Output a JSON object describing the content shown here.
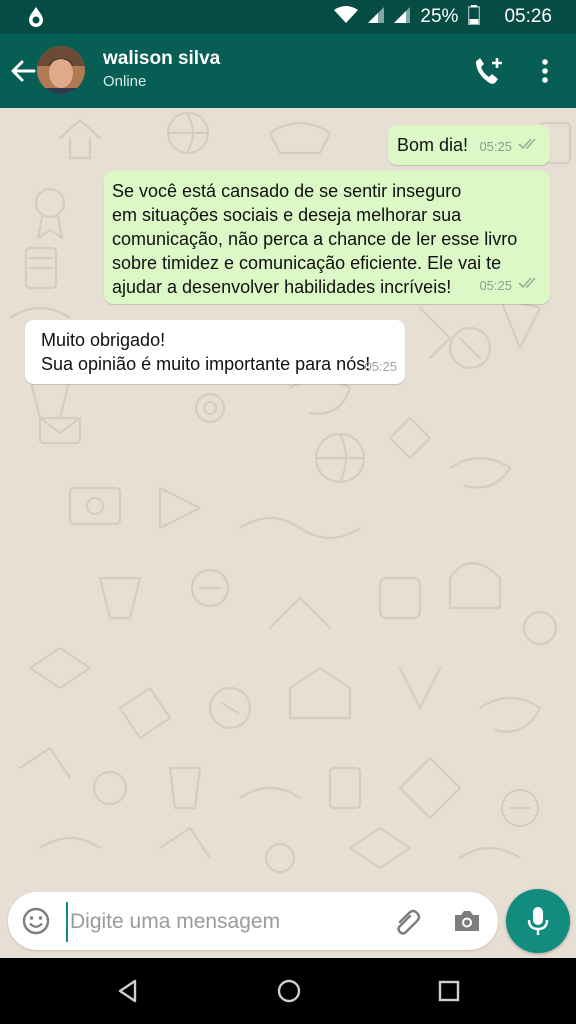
{
  "status_bar": {
    "battery_percent": "25%",
    "time": "05:26",
    "icons": [
      "app-notification-icon",
      "wifi-icon",
      "signal-icon",
      "signal-icon",
      "battery-icon"
    ]
  },
  "header": {
    "contact_name": "walison silva",
    "contact_status": "Online",
    "icons": [
      "back-arrow-icon",
      "avatar",
      "add-call-icon",
      "more-vert-icon"
    ]
  },
  "messages": [
    {
      "direction": "outgoing",
      "text": "Bom dia!",
      "time": "05:25",
      "status": "read"
    },
    {
      "direction": "outgoing",
      "text": "Se você está cansado de se sentir inseguro\n em situações sociais e deseja melhorar sua comunicação, não perca a chance de ler esse livro sobre timidez e comunicação eficiente. Ele vai te ajudar a desenvolver habilidades incríveis!",
      "time": "05:25",
      "status": "read"
    },
    {
      "direction": "incoming",
      "text": "Muito obrigado!\nSua opinião é muito importante para nós!",
      "time": "05:25"
    }
  ],
  "composer": {
    "placeholder": "Digite uma mensagem",
    "value": "",
    "icons": [
      "emoji-icon",
      "attach-icon",
      "camera-icon",
      "mic-icon"
    ]
  },
  "nav_bar": {
    "icons": [
      "nav-back-icon",
      "nav-home-icon",
      "nav-recents-icon"
    ]
  },
  "colors": {
    "status_bar": "#054d44",
    "header": "#075e54",
    "outgoing_bubble": "#dcf8c6",
    "incoming_bubble": "#ffffff",
    "chat_background": "#e7dfd4",
    "accent": "#128c7e"
  }
}
